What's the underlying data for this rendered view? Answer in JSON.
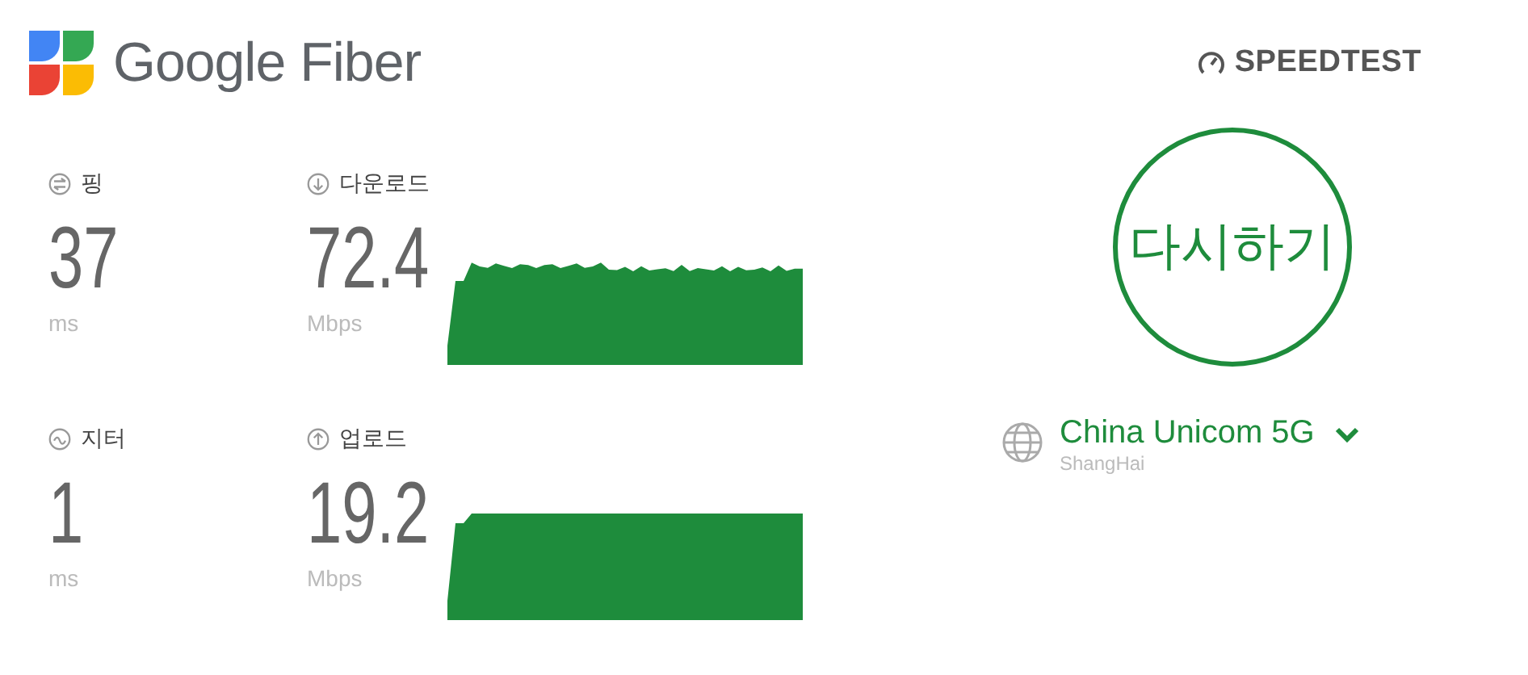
{
  "brand": {
    "name": "Google Fiber"
  },
  "speedtest": {
    "label": "SPEEDTEST"
  },
  "metrics": [
    {
      "kind": "ping",
      "label": "핑",
      "value": "37",
      "unit": "ms"
    },
    {
      "kind": "download",
      "label": "다운로드",
      "value": "72.4",
      "unit": "Mbps"
    },
    {
      "kind": "jitter",
      "label": "지터",
      "value": "1",
      "unit": "ms"
    },
    {
      "kind": "upload",
      "label": "업로드",
      "value": "19.2",
      "unit": "Mbps"
    }
  ],
  "restart_button": {
    "label": "다시하기"
  },
  "server": {
    "name": "China Unicom 5G",
    "location": "ShangHai"
  }
}
